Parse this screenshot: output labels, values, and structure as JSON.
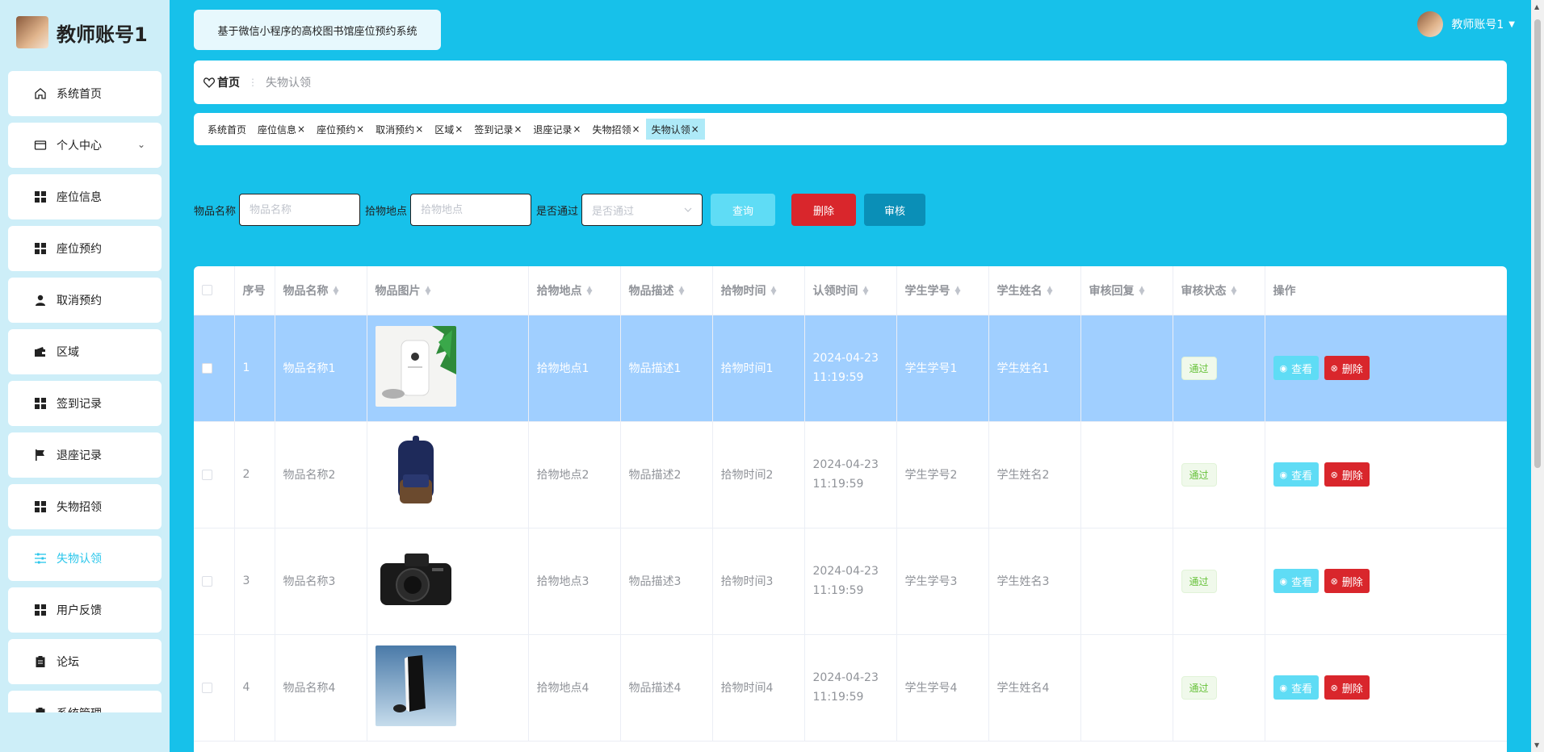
{
  "brand": {
    "title": "教师账号1"
  },
  "header": {
    "system_title": "基于微信小程序的高校图书馆座位预约系统",
    "user_name": "教师账号1"
  },
  "sidebar": {
    "items": [
      {
        "label": "系统首页",
        "icon": "home-icon"
      },
      {
        "label": "个人中心",
        "icon": "card-icon"
      },
      {
        "label": "座位信息",
        "icon": "grid-icon"
      },
      {
        "label": "座位预约",
        "icon": "grid-icon"
      },
      {
        "label": "取消预约",
        "icon": "user-icon"
      },
      {
        "label": "区域",
        "icon": "wallet-icon"
      },
      {
        "label": "签到记录",
        "icon": "grid-icon"
      },
      {
        "label": "退座记录",
        "icon": "flag-icon"
      },
      {
        "label": "失物招领",
        "icon": "grid-icon"
      },
      {
        "label": "失物认领",
        "icon": "sliders-icon"
      },
      {
        "label": "用户反馈",
        "icon": "grid-icon"
      },
      {
        "label": "论坛",
        "icon": "clipboard-icon"
      },
      {
        "label": "系统管理",
        "icon": "clipboard-icon"
      }
    ]
  },
  "breadcrumb": {
    "home": "首页",
    "current": "失物认领"
  },
  "tags": [
    "系统首页",
    "座位信息",
    "座位预约",
    "取消预约",
    "区域",
    "签到记录",
    "退座记录",
    "失物招领",
    "失物认领"
  ],
  "search": {
    "name_label": "物品名称",
    "name_placeholder": "物品名称",
    "place_label": "拾物地点",
    "place_placeholder": "拾物地点",
    "passed_label": "是否通过",
    "passed_placeholder": "是否通过",
    "query_label": "查询",
    "delete_label": "删除",
    "audit_label": "审核"
  },
  "table": {
    "columns": [
      "序号",
      "物品名称",
      "物品图片",
      "拾物地点",
      "物品描述",
      "拾物时间",
      "认领时间",
      "学生学号",
      "学生姓名",
      "审核回复",
      "审核状态",
      "操作"
    ],
    "rows": [
      {
        "no": "1",
        "name": "物品名称1",
        "place": "拾物地点1",
        "desc": "物品描述1",
        "found_time": "拾物时间1",
        "claim_time": "2024-04-23 11:19:59",
        "student_no": "学生学号1",
        "student_name": "学生姓名1",
        "reply": "",
        "status": "通过"
      },
      {
        "no": "2",
        "name": "物品名称2",
        "place": "拾物地点2",
        "desc": "物品描述2",
        "found_time": "拾物时间2",
        "claim_time": "2024-04-23 11:19:59",
        "student_no": "学生学号2",
        "student_name": "学生姓名2",
        "reply": "",
        "status": "通过"
      },
      {
        "no": "3",
        "name": "物品名称3",
        "place": "拾物地点3",
        "desc": "物品描述3",
        "found_time": "拾物时间3",
        "claim_time": "2024-04-23 11:19:59",
        "student_no": "学生学号3",
        "student_name": "学生姓名3",
        "reply": "",
        "status": "通过"
      },
      {
        "no": "4",
        "name": "物品名称4",
        "place": "拾物地点4",
        "desc": "物品描述4",
        "found_time": "拾物时间4",
        "claim_time": "2024-04-23 11:19:59",
        "student_no": "学生学号4",
        "student_name": "学生姓名4",
        "reply": "",
        "status": "通过"
      }
    ],
    "actions": {
      "view": "查看",
      "delete": "删除"
    }
  },
  "colors": {
    "primary": "#17c1ea",
    "danger": "#d9262c",
    "audit": "#0a8fb7",
    "selected_row": "#a0cfff",
    "success": "#67c23a"
  }
}
